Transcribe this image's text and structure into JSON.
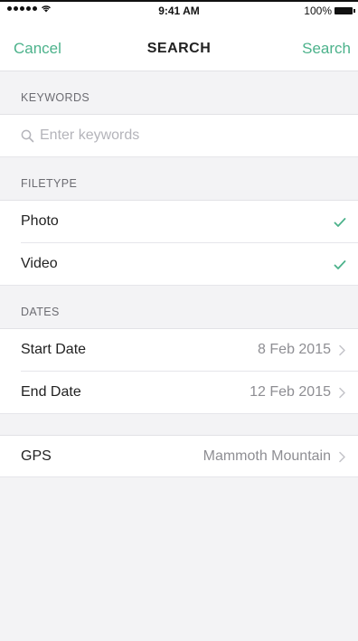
{
  "status_bar": {
    "time": "9:41 AM",
    "battery": "100%"
  },
  "nav": {
    "cancel": "Cancel",
    "title": "SEARCH",
    "search": "Search"
  },
  "keywords": {
    "header": "KEYWORDS",
    "placeholder": "Enter keywords",
    "value": ""
  },
  "filetype": {
    "header": "FILETYPE",
    "items": [
      {
        "label": "Photo",
        "checked": true
      },
      {
        "label": "Video",
        "checked": true
      }
    ]
  },
  "dates": {
    "header": "DATES",
    "items": [
      {
        "label": "Start Date",
        "value": "8 Feb 2015"
      },
      {
        "label": "End Date",
        "value": "12 Feb 2015"
      }
    ]
  },
  "gps": {
    "label": "GPS",
    "value": "Mammoth Mountain"
  },
  "colors": {
    "accent": "#4cb28b",
    "background": "#f3f3f5",
    "secondary_text": "#8e8e93"
  }
}
